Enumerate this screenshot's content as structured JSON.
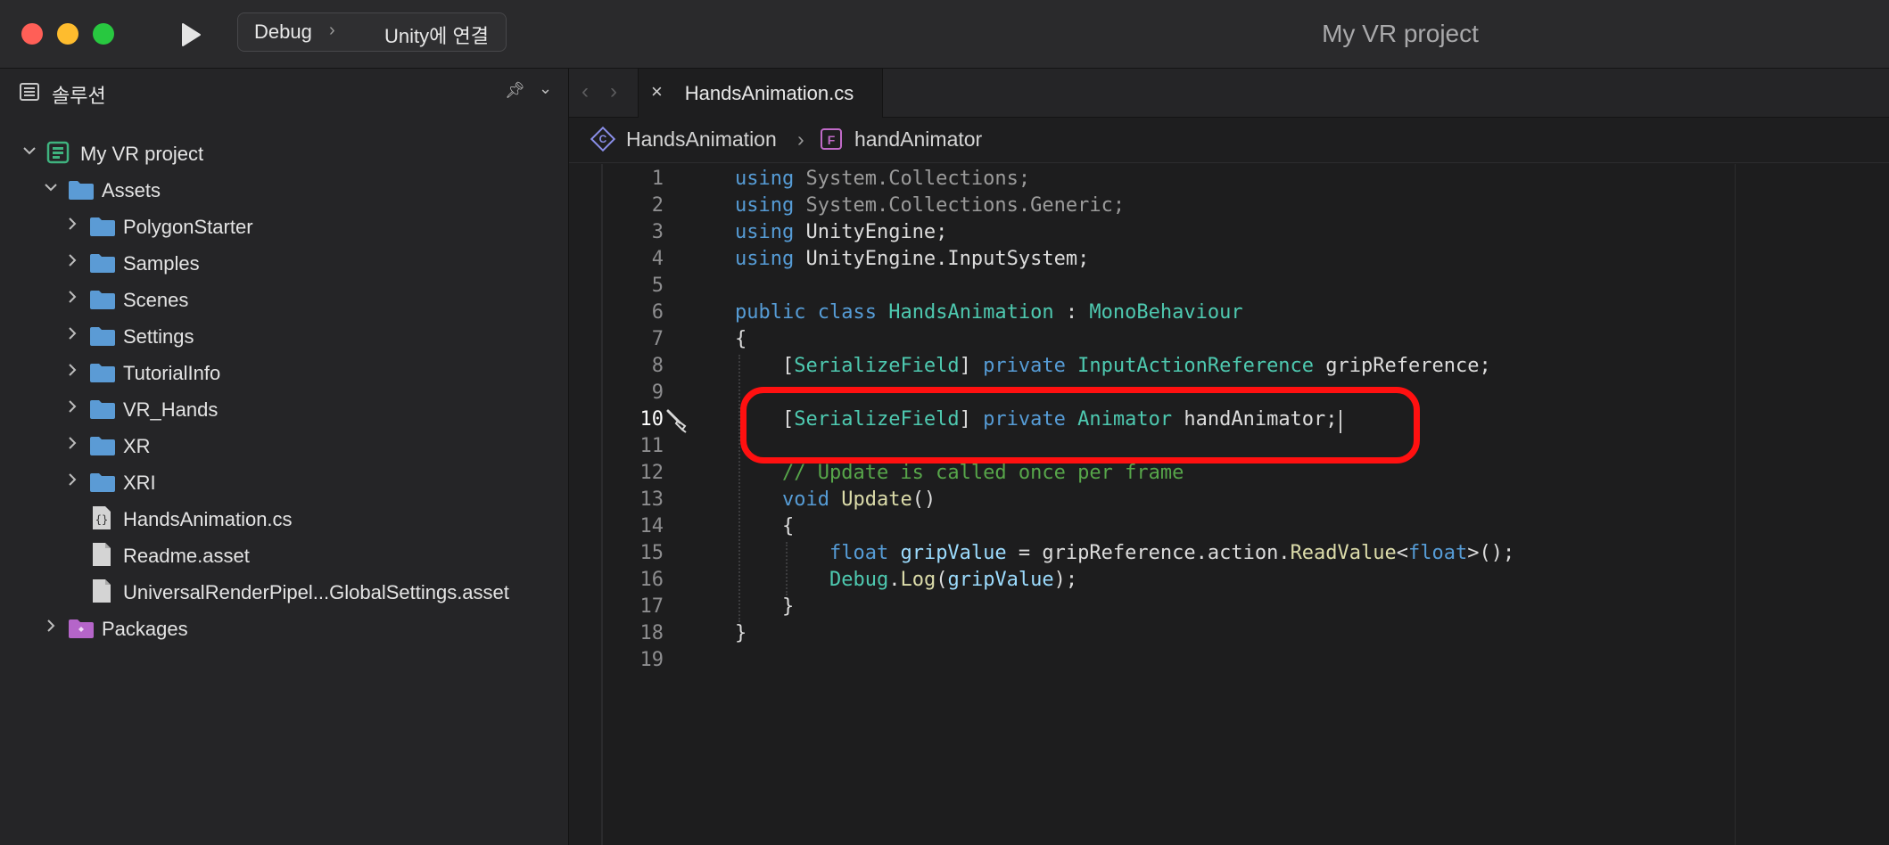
{
  "window": {
    "title": "My VR project",
    "run_button_icon": "play-icon",
    "configuration": "Debug",
    "run_target": "Unity에 연결"
  },
  "sidebar": {
    "title": "솔루션",
    "pin_icon": "pin-icon",
    "collapse_icon": "chevron-down-icon",
    "tree": [
      {
        "label": "My VR project",
        "kind": "project",
        "expanded": true,
        "depth": 0
      },
      {
        "label": "Assets",
        "kind": "folder",
        "expanded": true,
        "depth": 1
      },
      {
        "label": "PolygonStarter",
        "kind": "folder",
        "expanded": false,
        "depth": 2
      },
      {
        "label": "Samples",
        "kind": "folder",
        "expanded": false,
        "depth": 2
      },
      {
        "label": "Scenes",
        "kind": "folder",
        "expanded": false,
        "depth": 2
      },
      {
        "label": "Settings",
        "kind": "folder",
        "expanded": false,
        "depth": 2
      },
      {
        "label": "TutorialInfo",
        "kind": "folder",
        "expanded": false,
        "depth": 2
      },
      {
        "label": "VR_Hands",
        "kind": "folder",
        "expanded": false,
        "depth": 2
      },
      {
        "label": "XR",
        "kind": "folder",
        "expanded": false,
        "depth": 2
      },
      {
        "label": "XRI",
        "kind": "folder",
        "expanded": false,
        "depth": 2
      },
      {
        "label": "HandsAnimation.cs",
        "kind": "csfile",
        "depth": 2
      },
      {
        "label": "Readme.asset",
        "kind": "file",
        "depth": 2
      },
      {
        "label": "UniversalRenderPipel...GlobalSettings.asset",
        "kind": "file",
        "depth": 2
      },
      {
        "label": "Packages",
        "kind": "package",
        "expanded": false,
        "depth": 1
      }
    ]
  },
  "editor": {
    "tab": {
      "label": "HandsAnimation.cs",
      "close_icon": "close-icon"
    },
    "breadcrumb": {
      "class_badge": "C",
      "class_name": "HandsAnimation",
      "separator": "›",
      "field_badge": "F",
      "field_name": "handAnimator"
    },
    "current_line": 10,
    "code_lines": [
      {
        "n": "1",
        "tokens": [
          [
            "kw",
            "using"
          ],
          [
            "ns",
            " System.Collections;"
          ]
        ]
      },
      {
        "n": "2",
        "tokens": [
          [
            "kw",
            "using"
          ],
          [
            "ns",
            " System.Collections.Generic;"
          ]
        ]
      },
      {
        "n": "3",
        "tokens": [
          [
            "kw",
            "using"
          ],
          [
            "plain",
            " UnityEngine;"
          ]
        ]
      },
      {
        "n": "4",
        "tokens": [
          [
            "kw",
            "using"
          ],
          [
            "plain",
            " UnityEngine.InputSystem;"
          ]
        ]
      },
      {
        "n": "5",
        "tokens": []
      },
      {
        "n": "6",
        "tokens": [
          [
            "kw",
            "public"
          ],
          [
            "plain",
            " "
          ],
          [
            "kw",
            "class"
          ],
          [
            "plain",
            " "
          ],
          [
            "type",
            "HandsAnimation"
          ],
          [
            "plain",
            " : "
          ],
          [
            "type",
            "MonoBehaviour"
          ]
        ]
      },
      {
        "n": "7",
        "tokens": [
          [
            "plain",
            "{"
          ]
        ]
      },
      {
        "n": "8",
        "tokens": [
          [
            "plain",
            "    ["
          ],
          [
            "type",
            "SerializeField"
          ],
          [
            "plain",
            "] "
          ],
          [
            "kw",
            "private"
          ],
          [
            "plain",
            " "
          ],
          [
            "type",
            "InputActionReference"
          ],
          [
            "plain",
            " gripReference;"
          ]
        ]
      },
      {
        "n": "9",
        "tokens": []
      },
      {
        "n": "10",
        "tokens": [
          [
            "plain",
            "    ["
          ],
          [
            "type",
            "SerializeField"
          ],
          [
            "plain",
            "] "
          ],
          [
            "kw",
            "private"
          ],
          [
            "plain",
            " "
          ],
          [
            "type",
            "Animator"
          ],
          [
            "plain",
            " handAnimator;"
          ]
        ]
      },
      {
        "n": "11",
        "tokens": []
      },
      {
        "n": "12",
        "tokens": [
          [
            "cmt",
            "    // Update is called once per frame"
          ]
        ]
      },
      {
        "n": "13",
        "tokens": [
          [
            "plain",
            "    "
          ],
          [
            "kw",
            "void"
          ],
          [
            "plain",
            " "
          ],
          [
            "meth",
            "Update"
          ],
          [
            "plain",
            "()"
          ]
        ]
      },
      {
        "n": "14",
        "tokens": [
          [
            "plain",
            "    {"
          ]
        ]
      },
      {
        "n": "15",
        "tokens": [
          [
            "plain",
            "        "
          ],
          [
            "kw",
            "float"
          ],
          [
            "plain",
            " "
          ],
          [
            "var",
            "gripValue"
          ],
          [
            "plain",
            " = gripReference.action."
          ],
          [
            "meth",
            "ReadValue"
          ],
          [
            "plain",
            "<"
          ],
          [
            "kw",
            "float"
          ],
          [
            "plain",
            ">();"
          ]
        ]
      },
      {
        "n": "16",
        "tokens": [
          [
            "plain",
            "        "
          ],
          [
            "type",
            "Debug"
          ],
          [
            "plain",
            "."
          ],
          [
            "meth",
            "Log"
          ],
          [
            "plain",
            "("
          ],
          [
            "var",
            "gripValue"
          ],
          [
            "plain",
            ");"
          ]
        ]
      },
      {
        "n": "17",
        "tokens": [
          [
            "plain",
            "    }"
          ]
        ]
      },
      {
        "n": "18",
        "tokens": [
          [
            "plain",
            "}"
          ]
        ]
      },
      {
        "n": "19",
        "tokens": []
      }
    ]
  },
  "colors": {
    "highlight_box": "#ff1010",
    "keyword": "#569cd6",
    "type": "#4ec9b0",
    "comment": "#57a64a"
  }
}
